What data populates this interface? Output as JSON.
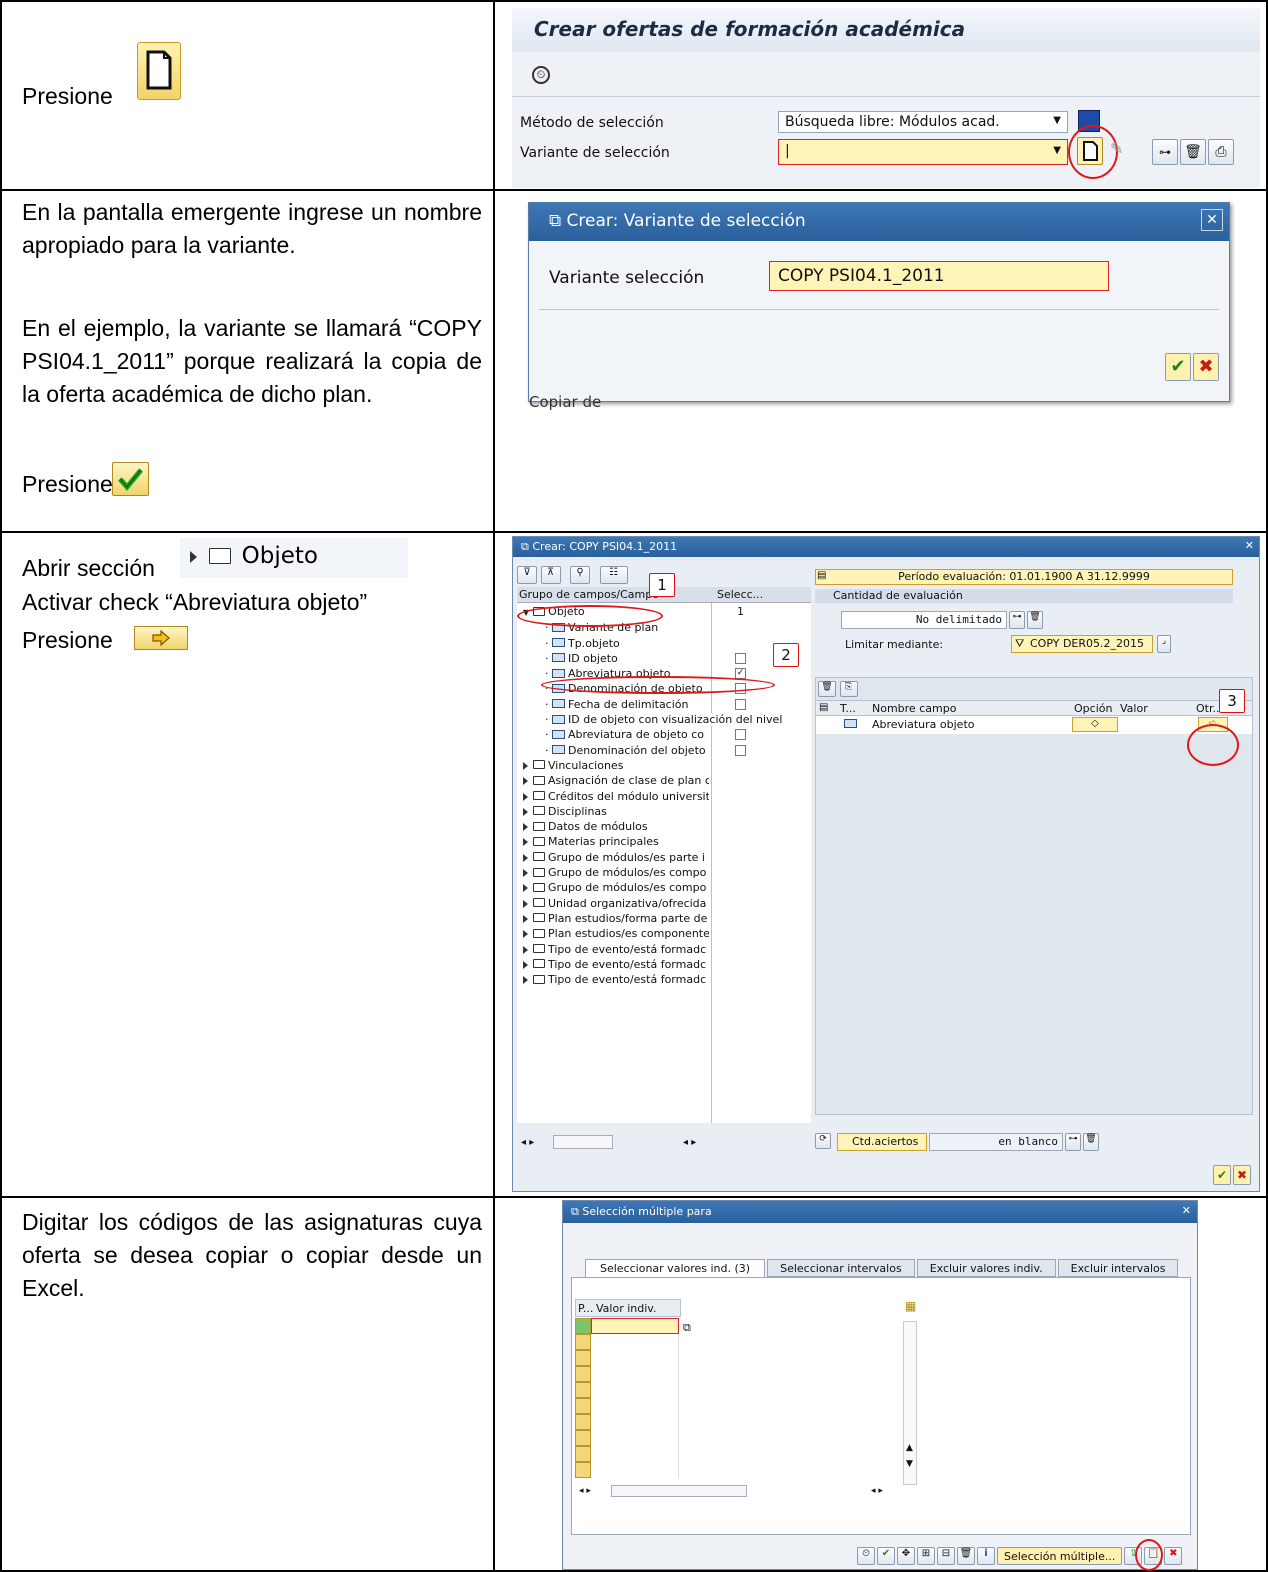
{
  "row1": {
    "instruction": "Presione",
    "sap": {
      "title": "Crear ofertas de formación académica",
      "method_label": "Método de selección",
      "method_value": "Búsqueda libre: Módulos acad.",
      "variant_label": "Variante de selección",
      "variant_value": "|"
    }
  },
  "row2": {
    "p1": "En la pantalla emergente ingrese un nombre apropiado para la variante.",
    "p2": "En el ejemplo, la variante se llamará “COPY PSI04.1_2011” porque realizará la copia de la oferta académica de dicho plan.",
    "press": "Presione",
    "dialog": {
      "title": "Crear: Variante de selección",
      "field_label": "Variante selección",
      "field_value": "COPY PSI04.1_2011",
      "background_text": "Copiar de"
    }
  },
  "row3": {
    "open_section": "Abrir sección",
    "open_section_target": "Objeto",
    "activate_check": "Activar check “Abreviatura objeto”",
    "press": "Presione",
    "window": {
      "title": "Crear: COPY PSI04.1_2011",
      "col_fields": "Grupo de campos/Campo",
      "col_select": "Selecc...",
      "objeto_label": "Objeto",
      "objeto_count": "1",
      "objeto_items": [
        {
          "label": "Variante de plan",
          "icon": "plan-icon",
          "checkbox": false,
          "checked": false
        },
        {
          "label": "Tp.objeto",
          "icon": "plan-icon",
          "checkbox": false,
          "checked": false
        },
        {
          "label": "ID objeto",
          "icon": "field-icon",
          "checkbox": true,
          "checked": false
        },
        {
          "label": "Abreviatura objeto",
          "icon": "field-icon",
          "checkbox": true,
          "checked": true
        },
        {
          "label": "Denominación de objeto",
          "icon": "field-icon",
          "checkbox": true,
          "checked": false
        },
        {
          "label": "Fecha de delimitación",
          "icon": "field-icon",
          "checkbox": true,
          "checked": false
        },
        {
          "label": "ID de objeto con visualización del nivel",
          "icon": "field-icon",
          "checkbox": false,
          "checked": false
        },
        {
          "label": "Abreviatura de objeto co",
          "icon": "field-icon",
          "checkbox": true,
          "checked": false
        },
        {
          "label": "Denominación del objeto",
          "icon": "field-icon",
          "checkbox": true,
          "checked": false
        }
      ],
      "folders": [
        "Vinculaciones",
        "Asignación de clase de plan c",
        "Créditos del módulo universit",
        "Disciplinas",
        "Datos de módulos",
        "Materias principales",
        "Grupo de módulos/es parte i",
        "Grupo de módulos/es compo",
        "Grupo de módulos/es compo",
        "Unidad organizativa/ofrecida j",
        "Plan estudios/forma parte de",
        "Plan estudios/es componente",
        "Tipo de evento/está formadc",
        "Tipo de evento/está formadc",
        "Tipo de evento/está formadc"
      ],
      "period": "Período evaluación: 01.01.1900 A 31.12.9999",
      "cantidad": "Cantidad de evaluación",
      "no_delimitado": "No delimitado",
      "limitar_label": "Limitar mediante:",
      "limitar_value": "COPY DER05.2_2015",
      "grid_headers": [
        "T...",
        "Nombre campo",
        "Opción",
        "Valor",
        "Otr..."
      ],
      "grid_row": "Abreviatura objeto",
      "ctd_label": "Ctd.aciertos",
      "ctd_value": "en blanco",
      "callouts": [
        "1",
        "2",
        "3"
      ]
    }
  },
  "row4": {
    "text": "Digitar los códigos de las asignaturas cuya oferta se desea copiar o copiar desde un Excel.",
    "dialog": {
      "title": "Selección múltiple para",
      "tabs": [
        "Seleccionar valores ind. (3)",
        "Seleccionar intervalos",
        "Excluir valores indiv.",
        "Excluir intervalos"
      ],
      "col_p": "P...",
      "col_val": "Valor indiv.",
      "multi_btn": "Selección múltiple..."
    }
  }
}
